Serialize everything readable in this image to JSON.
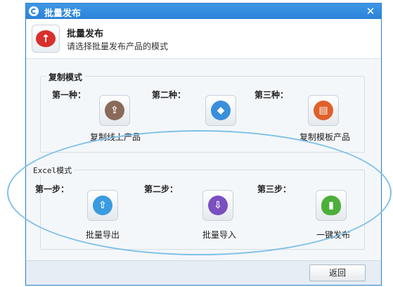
{
  "window": {
    "title": "批量发布",
    "close_glyph": "✕"
  },
  "header": {
    "title": "批量发布",
    "subtitle": "请选择批量发布产品的模式",
    "icon": "cloud-upload-icon"
  },
  "copy_mode": {
    "title": "复制模式",
    "steps": [
      {
        "label": "第一种：",
        "tile_label": "复制线上产品",
        "icon": "copy-online-icon",
        "color": "#8a6a58"
      },
      {
        "label": "第二种：",
        "tile_label": "",
        "icon": "cube-icon",
        "color": "#3a8fdc"
      },
      {
        "label": "第三种：",
        "tile_label": "复制模板产品",
        "icon": "copy-template-icon",
        "color": "#e0602a"
      }
    ]
  },
  "excel_mode": {
    "title": "Excel模式",
    "steps": [
      {
        "label": "第一步：",
        "tile_label": "批量导出",
        "icon": "export-icon",
        "color": "#3a9be0"
      },
      {
        "label": "第二步：",
        "tile_label": "批量导入",
        "icon": "import-icon",
        "color": "#7a4fc0"
      },
      {
        "label": "第三步：",
        "tile_label": "一键发布",
        "icon": "mouse-icon",
        "color": "#4caf3a"
      }
    ]
  },
  "footer": {
    "back_label": "返回"
  },
  "highlight_color": "#7fc0e8"
}
